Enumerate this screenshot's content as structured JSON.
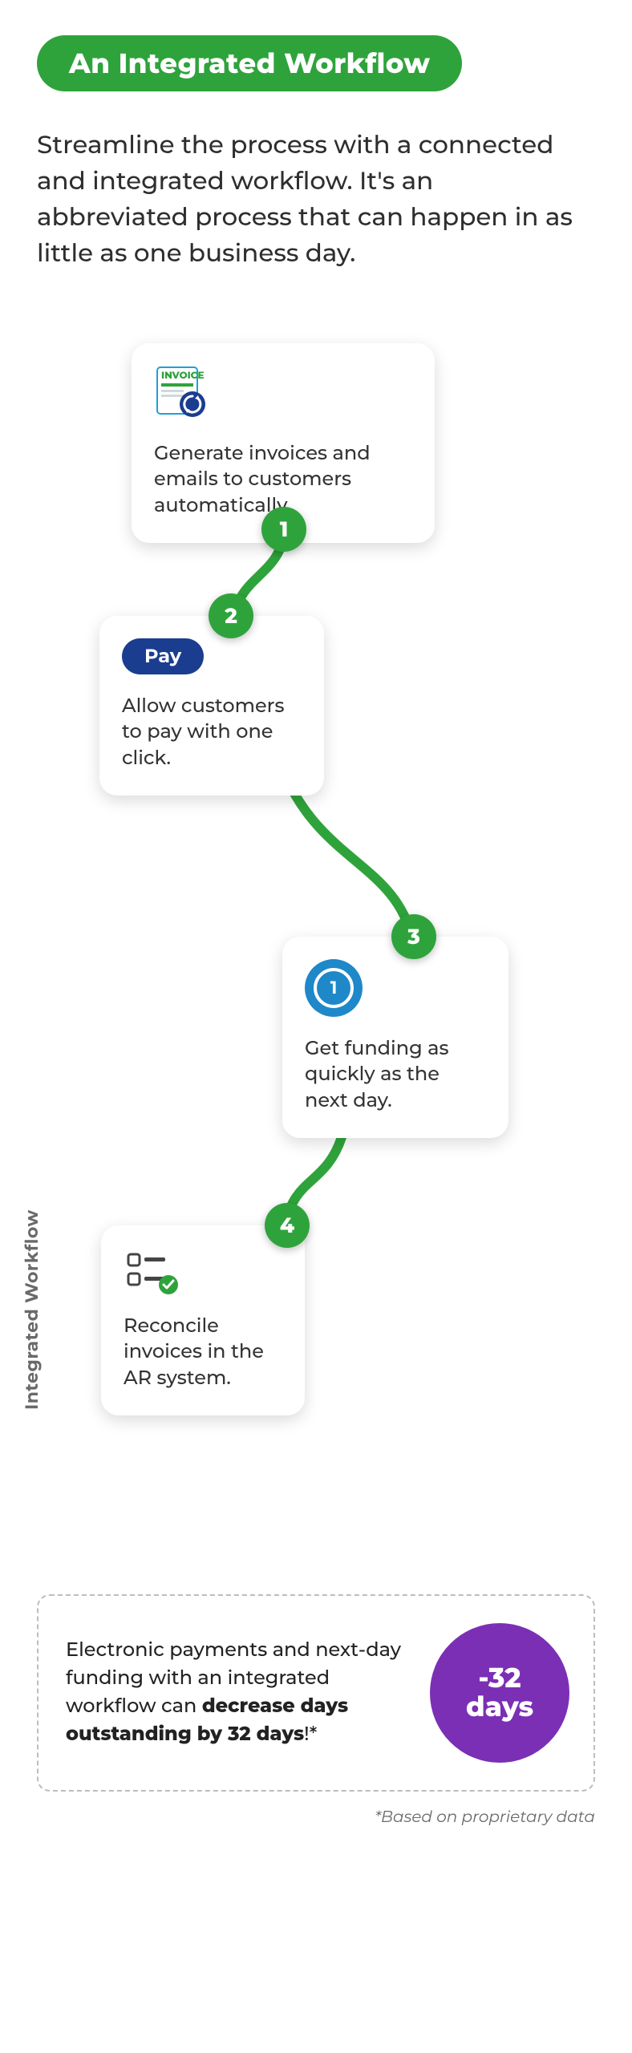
{
  "header": {
    "title": "An Integrated Workflow"
  },
  "intro": "Streamline the process with a connected and integrated workflow. It's an abbreviated process that can happen in as little as one business day.",
  "side_label": "Integrated Workflow",
  "steps": {
    "s1": {
      "num": "1",
      "text": "Generate invoices and emails to customers automatically.",
      "invoice_label": "INVOICE"
    },
    "s2": {
      "num": "2",
      "text": "Allow customers to pay with one click.",
      "pay_label": "Pay"
    },
    "s3": {
      "num": "3",
      "text": "Get funding as quickly as the next day.",
      "coin_glyph": "1"
    },
    "s4": {
      "num": "4",
      "text": "Reconcile invoices in the AR system."
    }
  },
  "callout": {
    "text_pre": "Electronic payments and next-day funding with an integrated workflow can ",
    "text_bold": "decrease days outstanding by 32 days",
    "text_post": "!*",
    "stat_line1": "-32",
    "stat_line2": "days"
  },
  "footnote": "*Based on proprietary data",
  "colors": {
    "green": "#2fa33b",
    "blue": "#1e88c9",
    "navy": "#1a3d8f",
    "purple": "#7b2fb5"
  }
}
